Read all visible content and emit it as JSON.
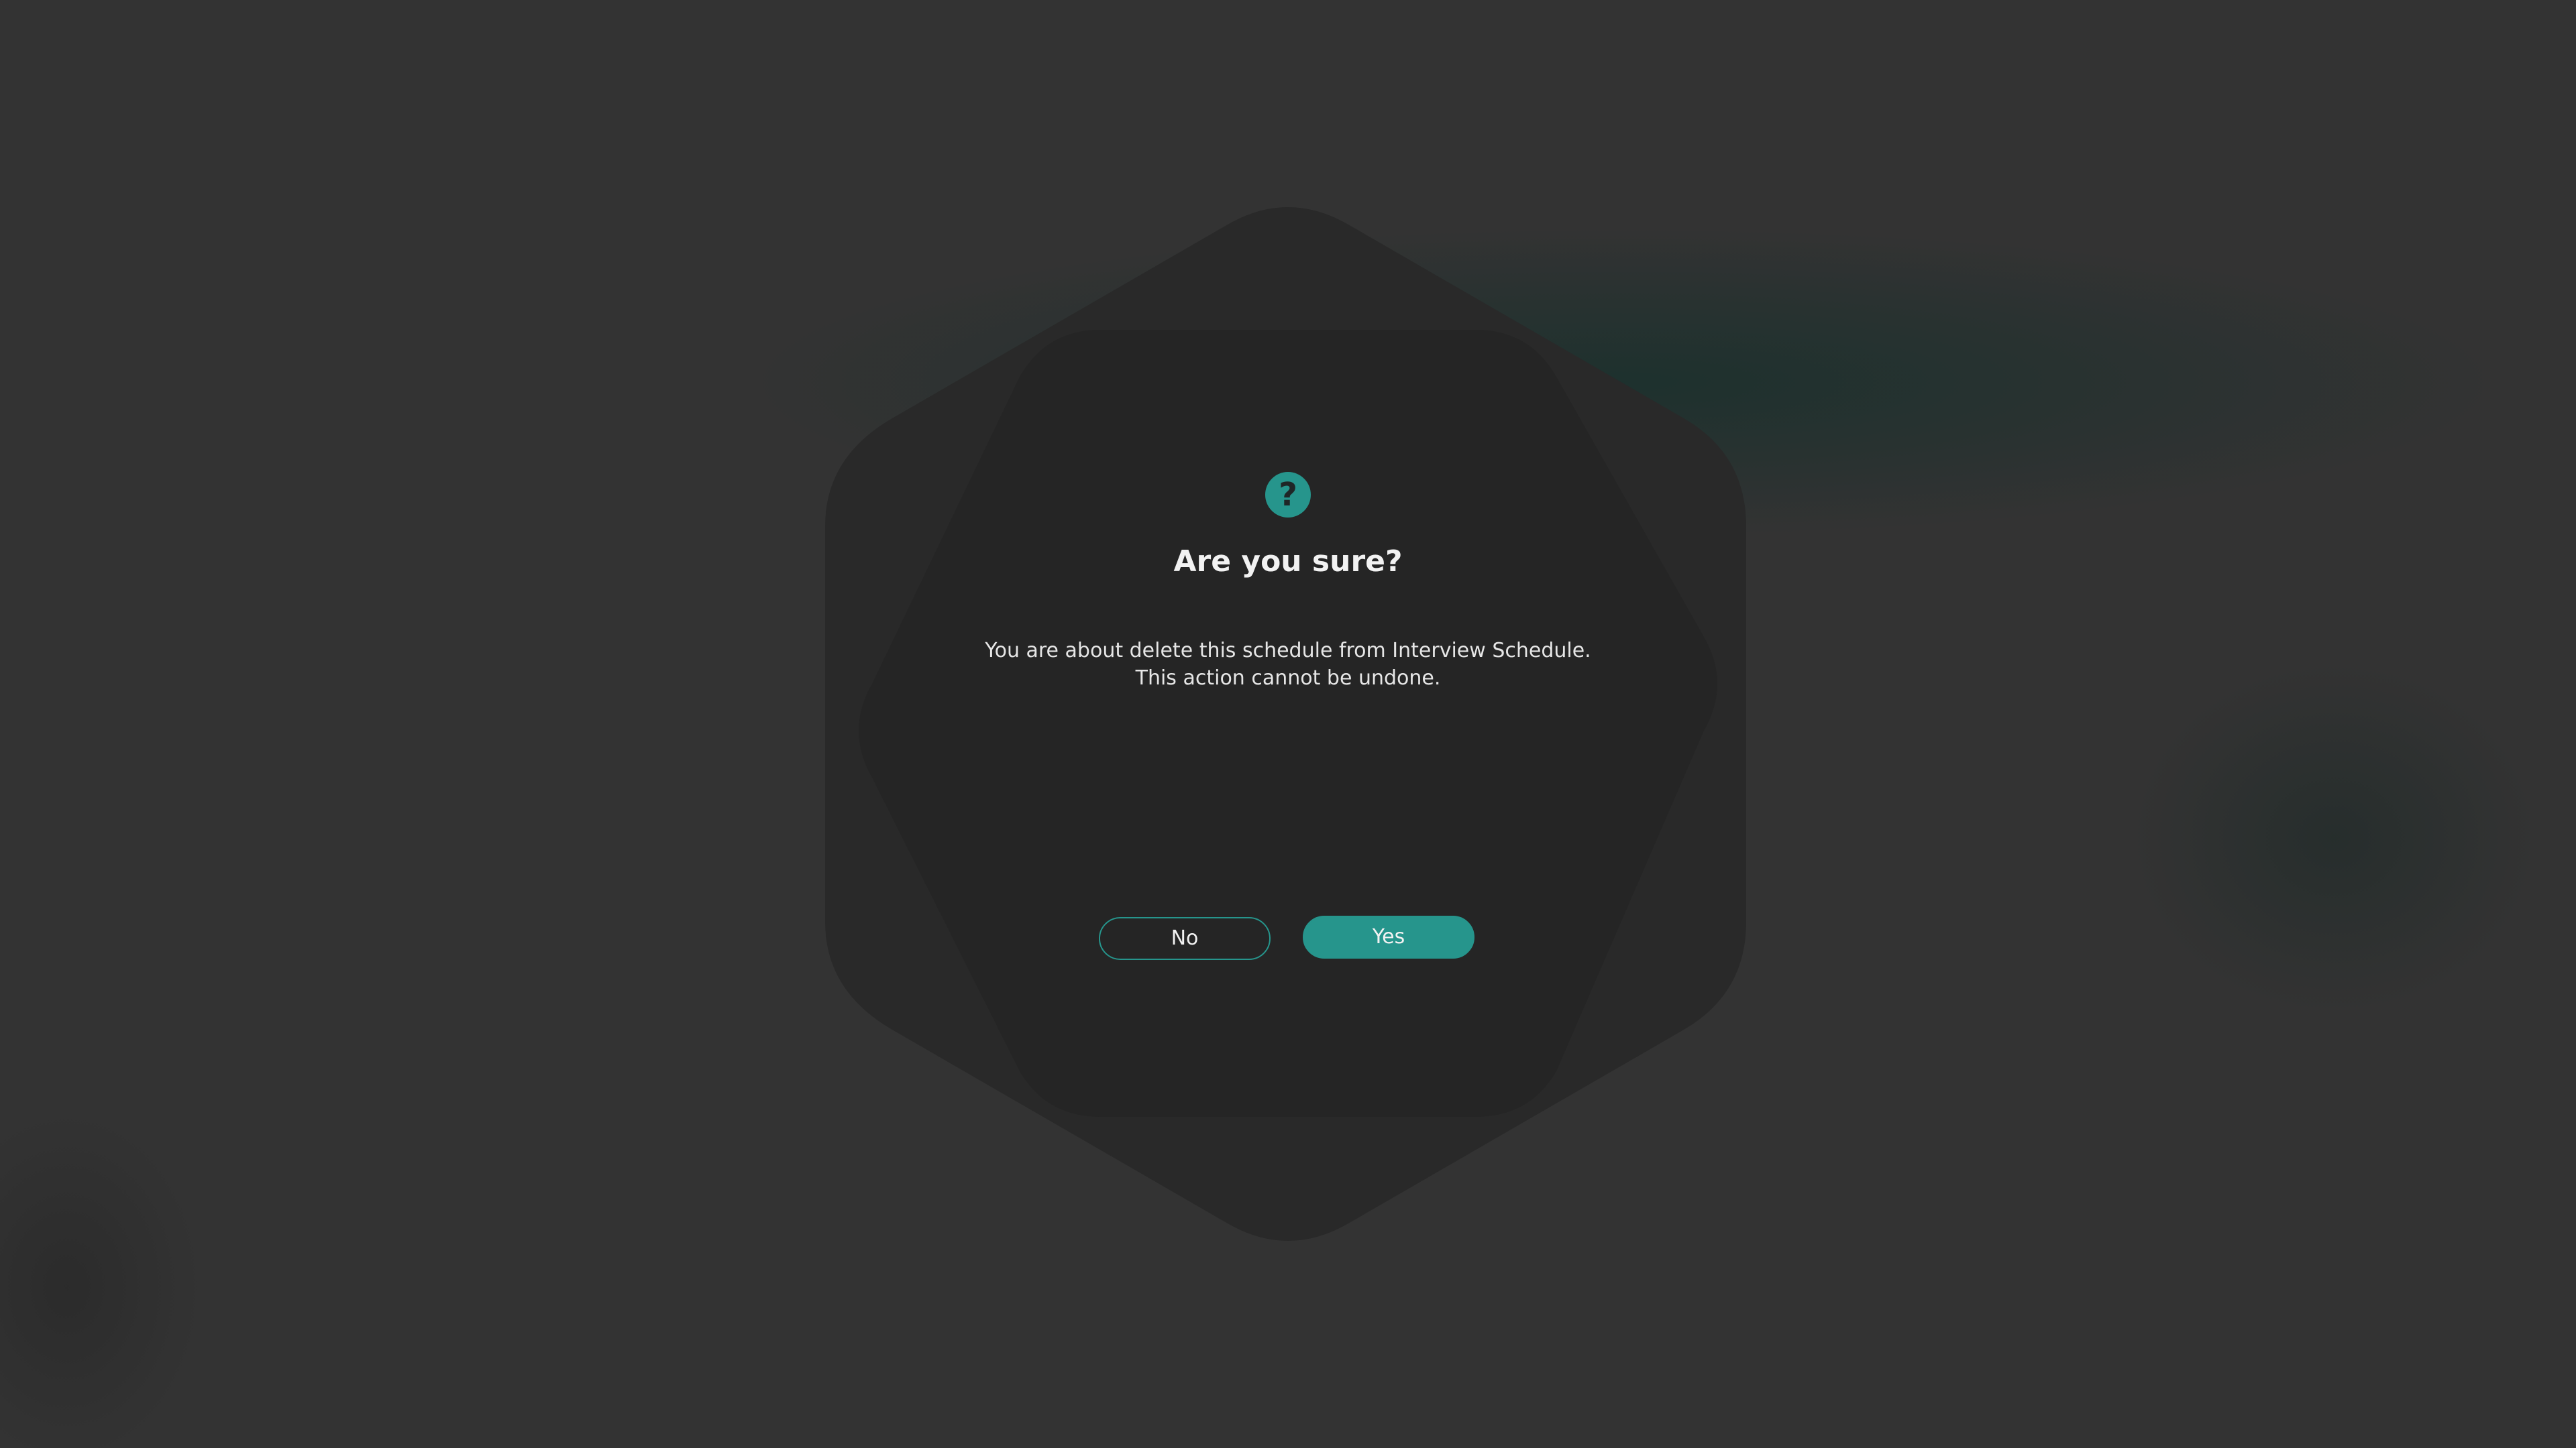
{
  "dialog": {
    "icon": "question-icon",
    "icon_glyph": "?",
    "title": "Are you sure?",
    "message_line1": "You are about delete this schedule from Interview Schedule.",
    "message_line2": "This action cannot be undone.",
    "no_label": "No",
    "yes_label": "Yes"
  },
  "colors": {
    "accent": "#26958c",
    "background": "#333333",
    "dialog_background": "#262626",
    "text": "#f2f2f2"
  }
}
